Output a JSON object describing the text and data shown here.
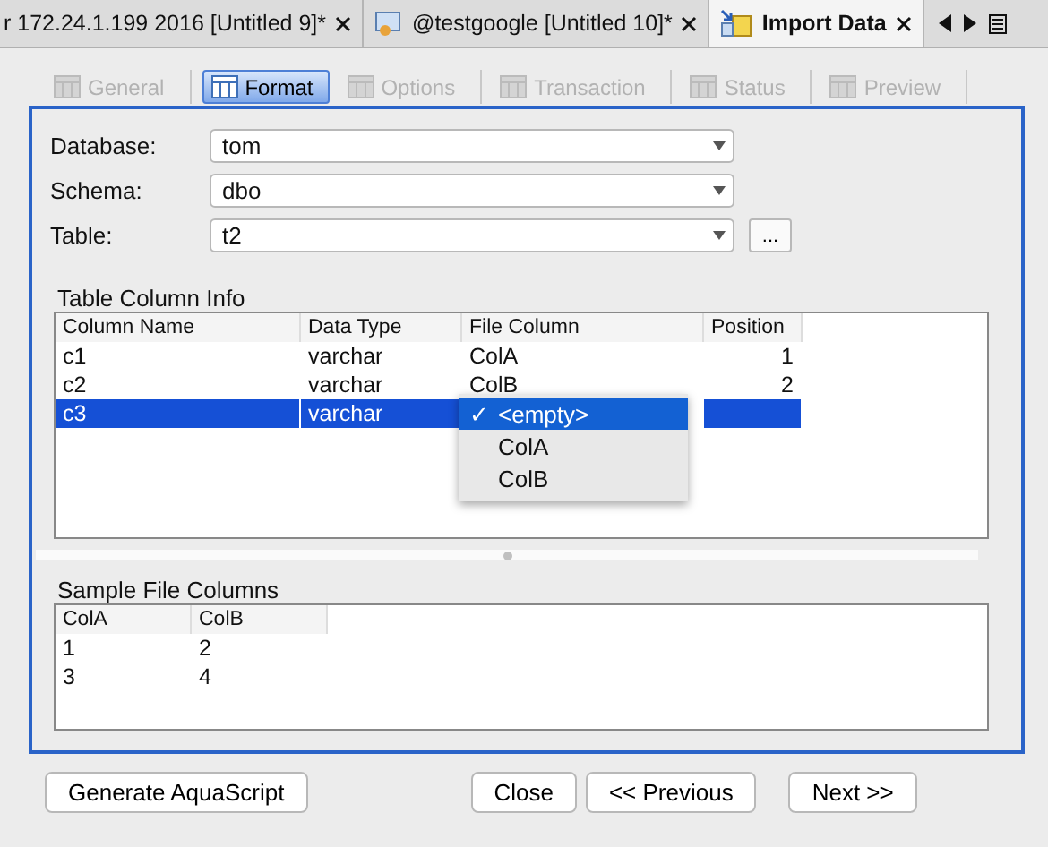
{
  "editor_tabs": [
    {
      "label": "r 172.24.1.199 2016 [Untitled 9]*",
      "selected": false,
      "kind": "plain"
    },
    {
      "label": "@testgoogle [Untitled 10]*",
      "selected": false,
      "kind": "query"
    },
    {
      "label": "Import Data",
      "selected": true,
      "kind": "import"
    }
  ],
  "wizard_tabs": [
    {
      "label": "General",
      "selected": false,
      "disabled": true
    },
    {
      "label": "Format",
      "selected": true,
      "disabled": false
    },
    {
      "label": "Options",
      "selected": false,
      "disabled": true
    },
    {
      "label": "Transaction",
      "selected": false,
      "disabled": true
    },
    {
      "label": "Status",
      "selected": false,
      "disabled": true
    },
    {
      "label": "Preview",
      "selected": false,
      "disabled": true
    }
  ],
  "fields": [
    {
      "label": "Database:",
      "value": "tom",
      "browse": false
    },
    {
      "label": "Schema:",
      "value": "dbo",
      "browse": false
    },
    {
      "label": "Table:",
      "value": "t2",
      "browse": true,
      "browse_label": "..."
    }
  ],
  "column_info": {
    "title": "Table Column Info",
    "columns": [
      "Column Name",
      "Data Type",
      "File Column",
      "Position"
    ],
    "rows": [
      {
        "cells": [
          "c1",
          "varchar",
          "ColA",
          "1"
        ],
        "selected": false
      },
      {
        "cells": [
          "c2",
          "varchar",
          "ColB",
          "2"
        ],
        "selected": false
      },
      {
        "cells": [
          "c3",
          "varchar",
          "",
          ""
        ],
        "selected": true
      }
    ],
    "dropdown": [
      {
        "label": "<empty>",
        "checked": true,
        "selected": true
      },
      {
        "label": "ColA",
        "checked": false,
        "selected": false
      },
      {
        "label": "ColB",
        "checked": false,
        "selected": false
      }
    ]
  },
  "sample": {
    "title": "Sample File Columns",
    "columns": [
      "ColA",
      "ColB"
    ],
    "rows": [
      [
        "1",
        "2"
      ],
      [
        "3",
        "4"
      ]
    ]
  },
  "buttons": [
    "Generate AquaScript",
    "Close",
    "<< Previous",
    "Next >>"
  ],
  "check_mark": "✓"
}
